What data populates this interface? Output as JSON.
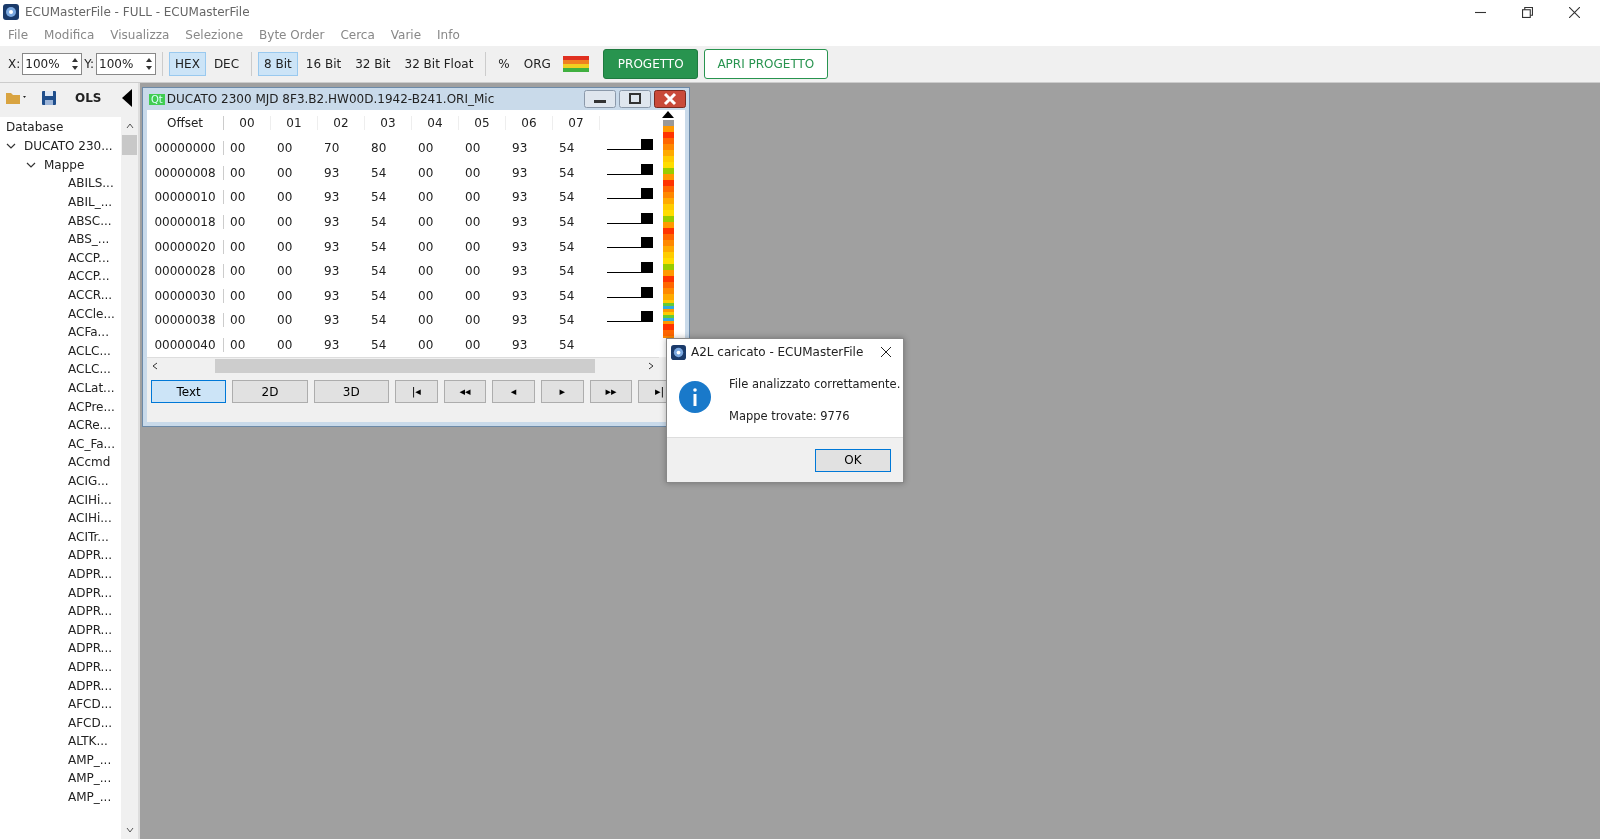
{
  "window": {
    "title": "ECUMasterFile - FULL - ECUMasterFile"
  },
  "menu": [
    "File",
    "Modifica",
    "Visualizza",
    "Selezione",
    "Byte Order",
    "Cerca",
    "Varie",
    "Info"
  ],
  "toolbar": {
    "x_label": "X:",
    "x_value": "100%",
    "y_label": "Y:",
    "y_value": "100%",
    "base": [
      {
        "label": "HEX",
        "selected": true
      },
      {
        "label": "DEC",
        "selected": false
      }
    ],
    "width": [
      {
        "label": "8 Bit",
        "selected": true
      },
      {
        "label": "16 Bit",
        "selected": false
      },
      {
        "label": "32 Bit",
        "selected": false
      },
      {
        "label": "32 Bit Float",
        "selected": false
      }
    ],
    "extra": [
      "%",
      "ORG"
    ],
    "buttons": [
      {
        "label": "PROGETTO",
        "kind": "primary"
      },
      {
        "label": "APRI PROGETTO",
        "kind": "outline"
      }
    ]
  },
  "sidebar": {
    "label": "OLS",
    "tree_title": "Database",
    "tree": [
      {
        "label": "DUCATO 230...",
        "expanded": true,
        "children": [
          {
            "label": "Mappe",
            "expanded": true,
            "children": [
              {
                "label": "ABILS..."
              },
              {
                "label": "ABIL_..."
              },
              {
                "label": "ABSC..."
              },
              {
                "label": "ABS_..."
              },
              {
                "label": "ACCP..."
              },
              {
                "label": "ACCP..."
              },
              {
                "label": "ACCR..."
              },
              {
                "label": "ACCle..."
              },
              {
                "label": "ACFa..."
              },
              {
                "label": "ACLC..."
              },
              {
                "label": "ACLC..."
              },
              {
                "label": "ACLat..."
              },
              {
                "label": "ACPre..."
              },
              {
                "label": "ACRe..."
              },
              {
                "label": "AC_Fa..."
              },
              {
                "label": "ACcmd"
              },
              {
                "label": "ACIG..."
              },
              {
                "label": "ACIHi..."
              },
              {
                "label": "ACIHi..."
              },
              {
                "label": "ACITr..."
              },
              {
                "label": "ADPR..."
              },
              {
                "label": "ADPR..."
              },
              {
                "label": "ADPR..."
              },
              {
                "label": "ADPR..."
              },
              {
                "label": "ADPR..."
              },
              {
                "label": "ADPR..."
              },
              {
                "label": "ADPR..."
              },
              {
                "label": "ADPR..."
              },
              {
                "label": "AFCD..."
              },
              {
                "label": "AFCD..."
              },
              {
                "label": "ALTK..."
              },
              {
                "label": "AMP_..."
              },
              {
                "label": "AMP_..."
              },
              {
                "label": "AMP_..."
              }
            ]
          }
        ]
      }
    ]
  },
  "hex_window": {
    "badge": "Qt",
    "title": "DUCATO 2300 MJD 8F3.B2.HW00D.1942-B241.ORI_Mic",
    "columns": [
      "Offset",
      "00",
      "01",
      "02",
      "03",
      "04",
      "05",
      "06",
      "07"
    ],
    "rows": [
      [
        "00000000",
        "00",
        "00",
        "70",
        "80",
        "00",
        "00",
        "93",
        "54"
      ],
      [
        "00000008",
        "00",
        "00",
        "93",
        "54",
        "00",
        "00",
        "93",
        "54"
      ],
      [
        "00000010",
        "00",
        "00",
        "93",
        "54",
        "00",
        "00",
        "93",
        "54"
      ],
      [
        "00000018",
        "00",
        "00",
        "93",
        "54",
        "00",
        "00",
        "93",
        "54"
      ],
      [
        "00000020",
        "00",
        "00",
        "93",
        "54",
        "00",
        "00",
        "93",
        "54"
      ],
      [
        "00000028",
        "00",
        "00",
        "93",
        "54",
        "00",
        "00",
        "93",
        "54"
      ],
      [
        "00000030",
        "00",
        "00",
        "93",
        "54",
        "00",
        "00",
        "93",
        "54"
      ],
      [
        "00000038",
        "00",
        "00",
        "93",
        "54",
        "00",
        "00",
        "93",
        "54"
      ],
      [
        "00000040",
        "00",
        "00",
        "93",
        "54",
        "00",
        "00",
        "93",
        "54"
      ]
    ],
    "views": [
      {
        "label": "Text",
        "selected": true
      },
      {
        "label": "2D",
        "selected": false
      },
      {
        "label": "3D",
        "selected": false
      }
    ],
    "nav": [
      "|◂",
      "◂◂",
      "◂",
      "▸",
      "▸▸",
      "▸|"
    ]
  },
  "dialog": {
    "title": "A2L caricato - ECUMasterFile",
    "message": "File analizzato correttamente.",
    "detail": "Mappe trovate: 9776",
    "button": "OK"
  }
}
